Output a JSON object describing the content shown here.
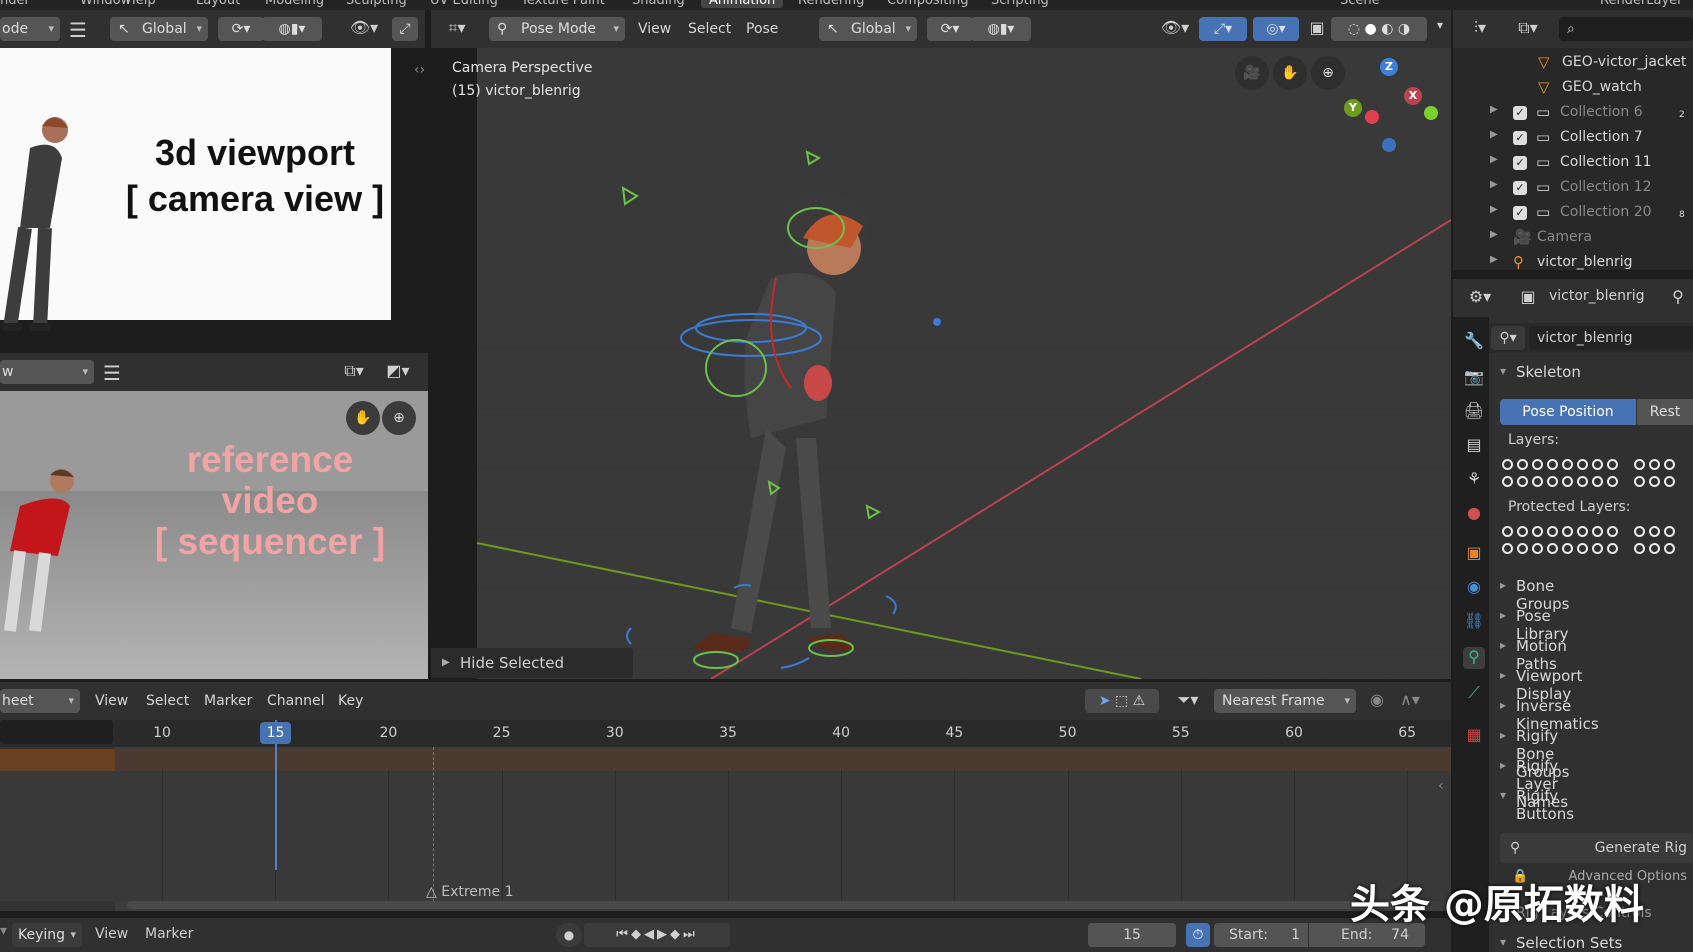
{
  "menubar": {
    "items": [
      "nder",
      "Window",
      "Help",
      "Layout",
      "Modeling",
      "Sculpting",
      "UV Editing",
      "Texture Paint",
      "Shading",
      "Animation",
      "Rendering",
      "Compositing",
      "Scripting"
    ],
    "active": "Animation",
    "scene": "Scene",
    "view_layer": "RenderLayer"
  },
  "left_header": {
    "mode": "ode",
    "orientation": "Global"
  },
  "camera_preview": {
    "overlay_line1": "3d viewport",
    "overlay_line2": "[ camera view ]"
  },
  "sequencer": {
    "view_select": "w",
    "overlay_line1": "reference",
    "overlay_line2": "video",
    "overlay_line3": "[ sequencer ]"
  },
  "viewport": {
    "mode": "Pose Mode",
    "menus": [
      "View",
      "Select",
      "Pose"
    ],
    "orientation": "Global",
    "info_line1": "Camera Perspective",
    "info_line2": "(15) victor_blenrig",
    "hide_selected": "Hide Selected",
    "gizmo": {
      "z": "Z",
      "x": "X",
      "y": "Y"
    }
  },
  "outliner": {
    "rows": [
      {
        "label": "GEO-victor_jacket",
        "dim": false,
        "icon": "mesh-icon"
      },
      {
        "label": "GEO_watch",
        "dim": false,
        "icon": "mesh-icon"
      },
      {
        "label": "Collection 6",
        "dim": true,
        "icon": "collection-icon",
        "badge": "2"
      },
      {
        "label": "Collection 7",
        "dim": false,
        "icon": "collection-icon"
      },
      {
        "label": "Collection 11",
        "dim": false,
        "icon": "collection-icon"
      },
      {
        "label": "Collection 12",
        "dim": true,
        "icon": "collection-icon"
      },
      {
        "label": "Collection 20",
        "dim": true,
        "icon": "collection-icon",
        "badge": "8"
      },
      {
        "label": "Camera",
        "dim": true,
        "icon": "camera-object-icon"
      },
      {
        "label": "victor_blenrig",
        "dim": false,
        "icon": "armature-icon"
      }
    ]
  },
  "properties": {
    "object_name": "victor_blenrig",
    "data_name": "victor_blenrig",
    "skeleton_label": "Skeleton",
    "pose_position": "Pose Position",
    "rest_position": "Rest",
    "layers_label": "Layers:",
    "protected_layers_label": "Protected Layers:",
    "panels": [
      "Bone Groups",
      "Pose Library",
      "Motion Paths",
      "Viewport Display",
      "Inverse Kinematics",
      "Rigify Bone Groups",
      "Rigify Layer Names",
      "Rigify Buttons"
    ],
    "generate_rig": "Generate Rig",
    "advanced_options": "Advanced Options",
    "rig_controls": "Rig Layers Controls",
    "selection_sets": "Selection Sets"
  },
  "dopesheet": {
    "editor": "heet",
    "menus": [
      "View",
      "Select",
      "Marker",
      "Channel",
      "Key"
    ],
    "snap": "Nearest Frame",
    "ticks": [
      "10",
      "15",
      "20",
      "25",
      "30",
      "35",
      "40",
      "45",
      "50",
      "55",
      "60",
      "65"
    ],
    "current_frame": "15",
    "marker": "Extreme 1"
  },
  "timeline": {
    "keying": "Keying",
    "menus": [
      "View",
      "Marker"
    ],
    "frame": "15",
    "start_label": "Start:",
    "start": "1",
    "end_label": "End:",
    "end": "74"
  },
  "watermark": "头条 @原拓数料",
  "colors": {
    "accent": "#4772b3",
    "playhead": "#5680c2",
    "x_axis": "#b9434f",
    "y_axis": "#6d9b1e"
  }
}
